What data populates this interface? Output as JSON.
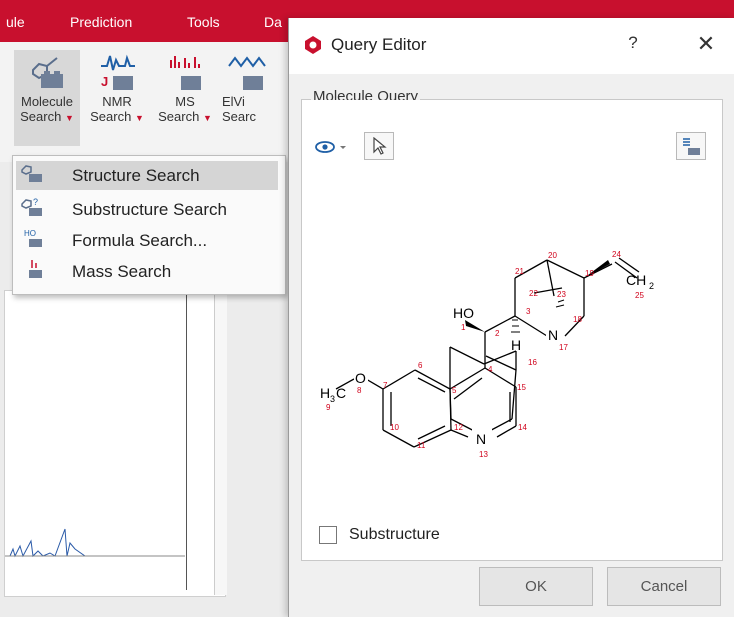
{
  "ribbon": {
    "tabs": [
      "ule",
      "Prediction",
      "Tools",
      "Da"
    ],
    "buttons": [
      {
        "line1": "Molecule",
        "line2": "Search",
        "icon": "molecule-search-icon"
      },
      {
        "line1": "NMR",
        "line2": "Search",
        "icon": "nmr-search-icon"
      },
      {
        "line1": "MS",
        "line2": "Search",
        "icon": "ms-search-icon"
      },
      {
        "line1": "ElVi",
        "line2": "Searc",
        "icon": "elvi-search-icon"
      }
    ]
  },
  "menu": {
    "items": [
      {
        "label": "Structure Search",
        "icon": "structure-search-icon"
      },
      {
        "label": "Substructure Search",
        "icon": "substructure-search-icon"
      },
      {
        "label": "Formula Search...",
        "icon": "formula-search-icon"
      },
      {
        "label": "Mass Search",
        "icon": "mass-search-icon"
      }
    ]
  },
  "dialog": {
    "title": "Query Editor",
    "help": "?",
    "close": "✕",
    "group_label": "Molecule Query",
    "checkbox_label": "Substructure",
    "ok_label": "OK",
    "cancel_label": "Cancel"
  },
  "molecule": {
    "labels": {
      "ho": "HO",
      "ch2": "CH",
      "ch2_sub": "2",
      "h3c": "H",
      "h3c_sub": "3",
      "h3c_c": "C",
      "o": "O",
      "n17": "N",
      "n13": "N",
      "h16": "H"
    },
    "atom_numbers": [
      "1",
      "2",
      "3",
      "4",
      "5",
      "6",
      "7",
      "8",
      "9",
      "10",
      "11",
      "12",
      "13",
      "14",
      "15",
      "16",
      "17",
      "18",
      "19",
      "20",
      "21",
      "22",
      "23",
      "24",
      "25"
    ]
  },
  "colors": {
    "accent": "#c8102e",
    "atom_number": "#d0021b"
  }
}
